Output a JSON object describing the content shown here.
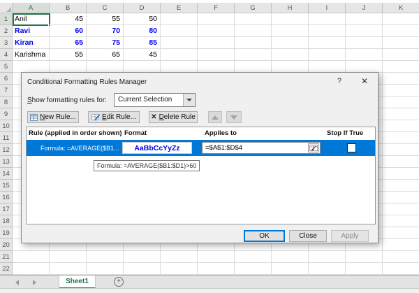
{
  "colors": {
    "excel_green": "#217346",
    "selection_blue": "#0078d7",
    "cf_font_blue": "#0000ee"
  },
  "grid": {
    "columns": [
      "A",
      "B",
      "C",
      "D",
      "E",
      "F",
      "G",
      "H",
      "I",
      "J",
      "K"
    ],
    "visible_rows": 22,
    "selected_column": "A",
    "selected_row": 1,
    "selected_cell": "A1",
    "rows": [
      {
        "name": "Anil",
        "values": [
          "45",
          "55",
          "50"
        ],
        "cf": false
      },
      {
        "name": "Ravi",
        "values": [
          "60",
          "70",
          "80"
        ],
        "cf": true
      },
      {
        "name": "Kiran",
        "values": [
          "65",
          "75",
          "85"
        ],
        "cf": true
      },
      {
        "name": "Karishma",
        "values": [
          "55",
          "65",
          "45"
        ],
        "cf": false
      }
    ]
  },
  "dialog": {
    "title": "Conditional Formatting Rules Manager",
    "help_icon": "?",
    "close_icon": "✕",
    "show_label_accel": "S",
    "show_label_rest": "how formatting rules for:",
    "combo_value": "Current Selection",
    "new_rule_accel": "N",
    "new_rule_rest": "ew Rule...",
    "edit_rule_accel": "E",
    "edit_rule_rest": "dit Rule...",
    "delete_rule_accel": "D",
    "delete_rule_rest": "elete Rule",
    "delete_icon": "✕",
    "list": {
      "col_rule": "Rule (applied in order shown)",
      "col_format": "Format",
      "col_applies": "Applies to",
      "col_stop": "Stop If True",
      "rule_name": "Formula: =AVERAGE($B1...",
      "format_preview": "AaBbCcYyZz",
      "applies_to": "=$A$1:$D$4",
      "stop_if_true_checked": false
    },
    "tooltip": "Formula: =AVERAGE($B1:$D1)>60",
    "ok": "OK",
    "close": "Close",
    "apply": "Apply"
  },
  "sheet_tabs": {
    "active": "Sheet1",
    "add_icon": "+"
  }
}
